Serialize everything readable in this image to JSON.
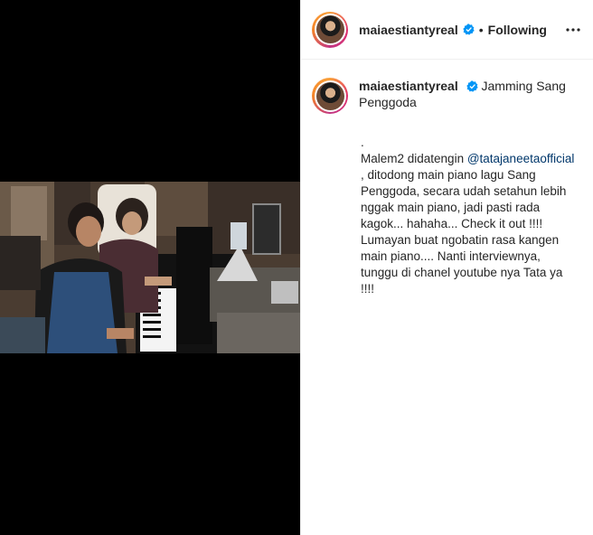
{
  "post": {
    "username": "maiaestiantyreal",
    "verified_icon": "verified-badge-icon",
    "separator": "•",
    "follow_status": "Following",
    "more_icon": "more-options-icon"
  },
  "caption": {
    "title": "Jamming Sang Penggoda",
    "dot_line": ".",
    "line_intro": "Malem2 didatengin ",
    "mention": "@tatajaneetaofficial",
    "body": " , ditodong main piano lagu Sang Penggoda, secara udah setahun lebih nggak main piano, jadi pasti rada kagok... hahaha... Check it out !!!! Lumayan buat ngobatin rasa kangen main piano.... Nanti interviewnya, tunggu di chanel youtube nya Tata ya !!!!"
  },
  "colors": {
    "accent_blue": "#0095f6",
    "text_primary": "#262626",
    "mention_link": "#00376b",
    "media_background": "#000000"
  }
}
